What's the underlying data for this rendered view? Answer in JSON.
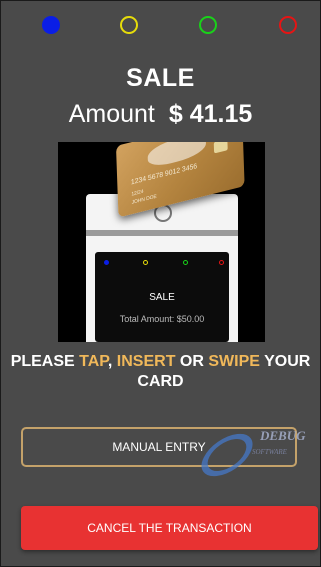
{
  "status_dots": [
    {
      "name": "blue-status-dot",
      "color": "#0a1ee6",
      "style": "filled"
    },
    {
      "name": "yellow-status-dot",
      "color": "#e6dc0a",
      "style": "ring"
    },
    {
      "name": "green-status-dot",
      "color": "#19d219",
      "style": "ring"
    },
    {
      "name": "red-status-dot",
      "color": "#e61414",
      "style": "ring"
    }
  ],
  "header": {
    "title": "SALE",
    "amount_label": "Amount",
    "amount_value": "$ 41.15"
  },
  "terminal_illustration": {
    "screen_title": "SALE",
    "screen_amount": "Total Amount: $50.00",
    "card_number": "1234 5678 9012 3456",
    "card_expiry": "12/24",
    "card_holder": "JOHN DOE"
  },
  "prompt": {
    "part1": "PLEASE ",
    "tap": "TAP",
    "sep1": ", ",
    "insert": "INSERT",
    "sep2": " OR ",
    "swipe": "SWIPE",
    "part2": " YOUR CARD",
    "highlight_color": "#f0b85a"
  },
  "buttons": {
    "manual_entry": "MANUAL ENTRY",
    "cancel": "CANCEL THE TRANSACTION"
  },
  "watermark": {
    "brand": "DEBUG",
    "subtitle": "SOFTWARE"
  }
}
